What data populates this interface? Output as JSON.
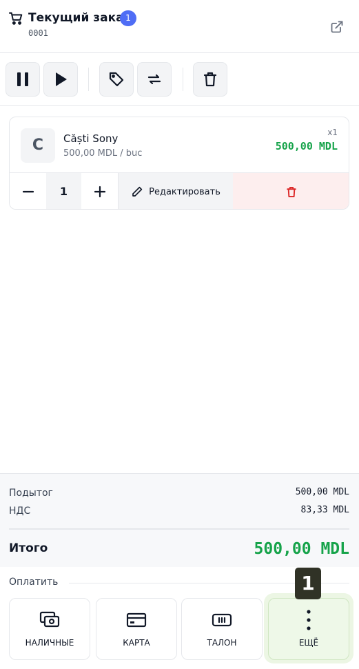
{
  "header": {
    "title": "Текущий заказ",
    "item_count": "1",
    "order_number": "0001"
  },
  "toolbar": {
    "buttons": [
      "pause",
      "play",
      "tag",
      "swap",
      "trash"
    ]
  },
  "items": [
    {
      "avatar_letter": "C",
      "name": "Căști Sony",
      "unit_price": "500,00 MDL / buc",
      "quantity_label": "x1",
      "total": "500,00 MDL",
      "quantity": "1",
      "edit_label": "Редактировать"
    }
  ],
  "totals": {
    "subtotal_label": "Подытог",
    "subtotal_value": "500,00 MDL",
    "vat_label": "НДС",
    "vat_value": "83,33 MDL",
    "total_label": "Итого",
    "total_value": "500,00 MDL"
  },
  "payment": {
    "section_label": "Оплатить",
    "methods": [
      {
        "label": "НАЛИЧНЫЕ",
        "icon": "cash-icon"
      },
      {
        "label": "КАРТА",
        "icon": "card-icon"
      },
      {
        "label": "ТАЛОН",
        "icon": "voucher-icon"
      },
      {
        "label": "ЕЩЁ",
        "icon": "more-vertical-icon"
      }
    ],
    "shortcut_badge": "1"
  },
  "colors": {
    "accent_green": "#16a34a",
    "badge_blue": "#4f6df5",
    "danger_red": "#dc2626",
    "highlight_green": "#ecf6e4"
  }
}
